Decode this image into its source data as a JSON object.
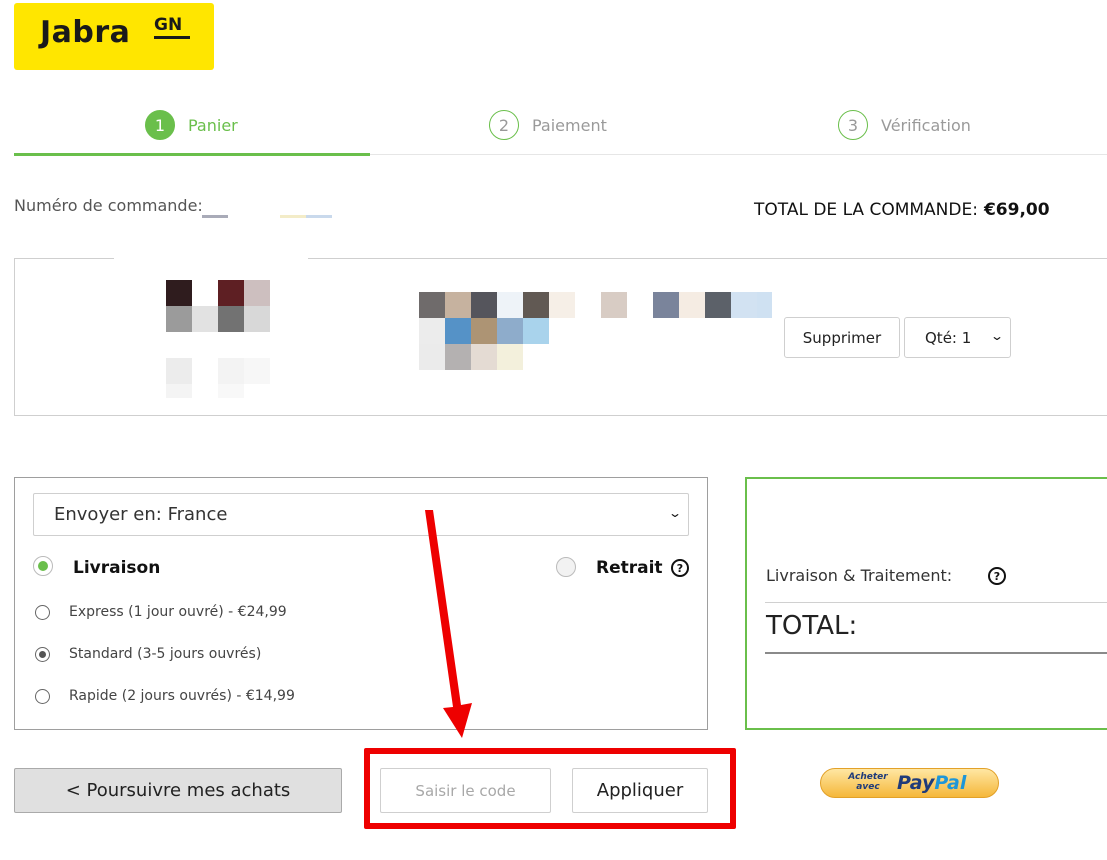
{
  "logo": {
    "brand": "Jabra",
    "suffix": "GN"
  },
  "steps": [
    {
      "number": "1",
      "label": "Panier"
    },
    {
      "number": "2",
      "label": "Paiement"
    },
    {
      "number": "3",
      "label": "Vérification"
    }
  ],
  "order": {
    "number_label": "Numéro de commande:",
    "total_label": "TOTAL DE LA COMMANDE:",
    "total_value": "€69,00"
  },
  "cart_item": {
    "remove_label": "Supprimer",
    "quantity_label": "Qté: 1"
  },
  "shipping": {
    "country_select": "Envoyer en: France",
    "delivery_label": "Livraison",
    "pickup_label": "Retrait",
    "options": [
      {
        "label": "Express (1 jour ouvré) - €24,99",
        "selected": false
      },
      {
        "label": "Standard (3-5 jours ouvrés)",
        "selected": true
      },
      {
        "label": "Rapide (2 jours ouvrés) - €14,99",
        "selected": false
      }
    ]
  },
  "summary": {
    "shipping_label": "Livraison & Traitement:",
    "total_label": "TOTAL:"
  },
  "actions": {
    "continue_label": "< Poursuivre mes achats",
    "code_placeholder": "Saisir le code",
    "apply_label": "Appliquer",
    "paypal_small": "Acheter avec",
    "paypal_pay": "Pay",
    "paypal_pal": "Pal"
  },
  "colors": {
    "brand_yellow": "#FFE600",
    "accent_green": "#6abf4b",
    "annotation_red": "#ee0000"
  }
}
